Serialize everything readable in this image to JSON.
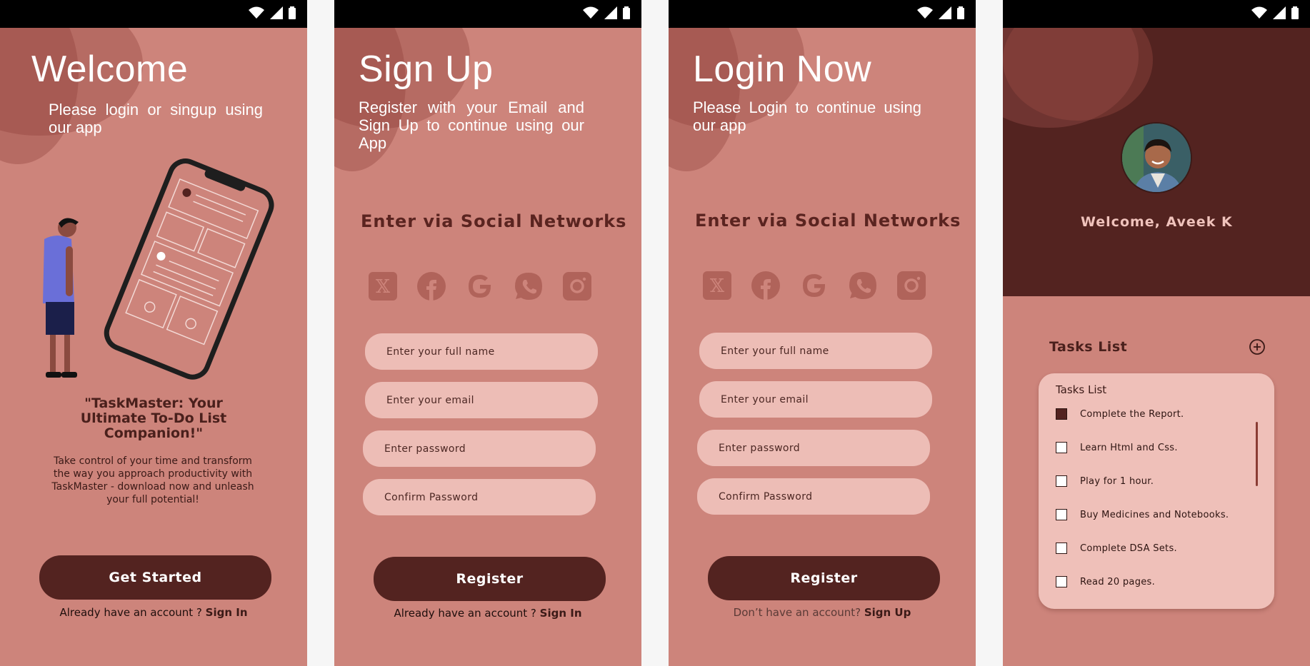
{
  "welcome_screen": {
    "title": "Welcome",
    "subtitle": "Please login or singup using our app",
    "quote": "\"TaskMaster: Your Ultimate To-Do List Companion!\"",
    "description": "Take control of your time and transform the way you approach productivity with TaskMaster - download now and unleash your full potential!",
    "cta_label": "Get Started",
    "footer_prefix": "Already have an account ?",
    "footer_link": "Sign In"
  },
  "signup_screen": {
    "title": "Sign Up",
    "subtitle": "Register with your Email and Sign Up to continue using our App",
    "social_heading": "Enter via Social Networks",
    "social_icons": [
      "x-icon",
      "facebook-icon",
      "google-icon",
      "whatsapp-icon",
      "instagram-icon"
    ],
    "fields": {
      "full_name_placeholder": "Enter your full name",
      "email_placeholder": "Enter your email",
      "password_placeholder": "Enter password",
      "confirm_placeholder": "Confirm Password"
    },
    "cta_label": "Register",
    "footer_prefix": "Already have an account ?",
    "footer_link": "Sign In"
  },
  "login_screen": {
    "title": "Login Now",
    "subtitle": "Please Login to continue using our app",
    "social_heading": "Enter via Social Networks",
    "fields": {
      "full_name_placeholder": "Enter your full name",
      "email_placeholder": "Enter your email",
      "password_placeholder": "Enter password",
      "confirm_placeholder": "Confirm Password"
    },
    "cta_label": "Register",
    "footer_prefix": "Don’t have an account?",
    "footer_link": "Sign Up"
  },
  "tasks_screen": {
    "welcome": "Welcome, Aveek K",
    "section_title": "Tasks List",
    "card_title": "Tasks List",
    "tasks": [
      {
        "label": "Complete the Report.",
        "checked": true
      },
      {
        "label": "Learn Html and Css.",
        "checked": false
      },
      {
        "label": "Play for 1 hour.",
        "checked": false
      },
      {
        "label": "Buy Medicines and Notebooks.",
        "checked": false
      },
      {
        "label": "Complete DSA Sets.",
        "checked": false
      },
      {
        "label": "Read 20 pages.",
        "checked": false
      }
    ]
  },
  "colors": {
    "background": "#cd847b",
    "primary_dark": "#532320",
    "input_fill": "#edbdb6",
    "statusbar": "#000000"
  }
}
